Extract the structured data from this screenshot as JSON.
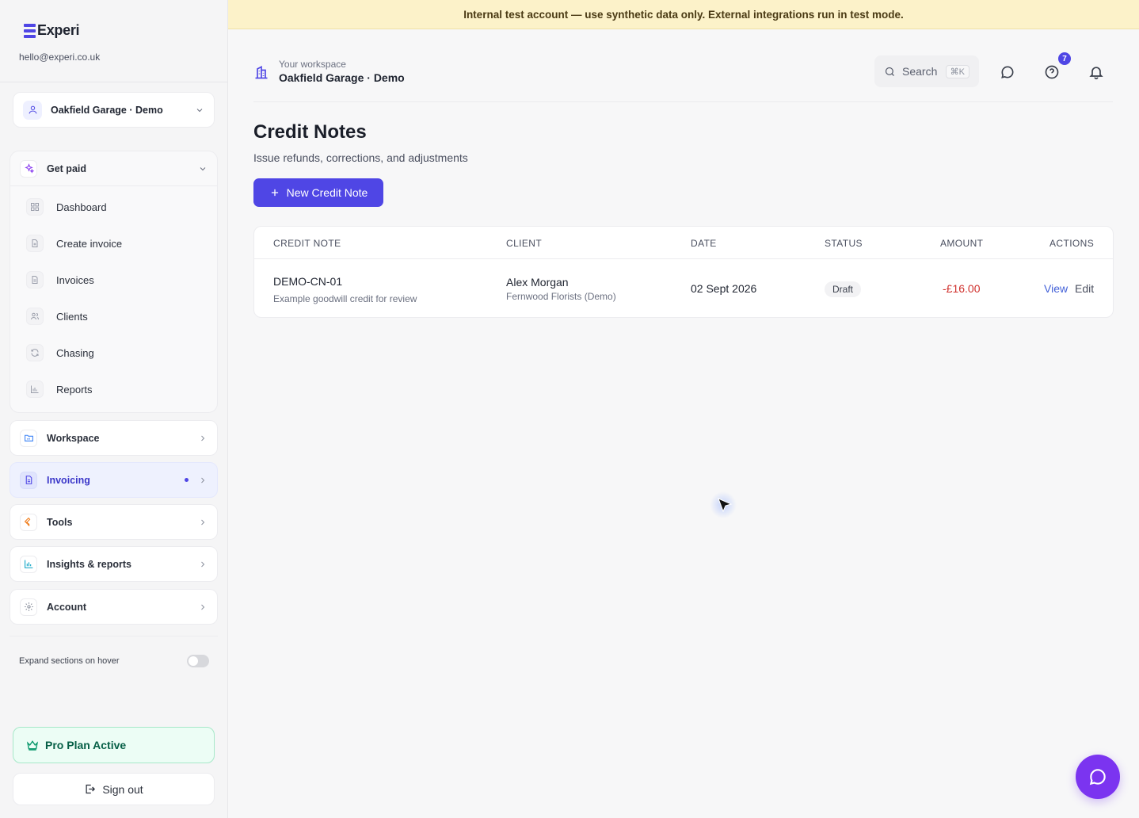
{
  "brand": {
    "name": "Experi",
    "email": "hello@experi.co.uk"
  },
  "workspace_selector": {
    "label": "Oakfield Garage · Demo"
  },
  "nav": {
    "get_paid": {
      "label": "Get paid",
      "items": [
        {
          "label": "Dashboard",
          "icon": "grid-icon"
        },
        {
          "label": "Create invoice",
          "icon": "file-plus-icon"
        },
        {
          "label": "Invoices",
          "icon": "file-text-icon"
        },
        {
          "label": "Clients",
          "icon": "users-icon"
        },
        {
          "label": "Chasing",
          "icon": "refresh-icon"
        },
        {
          "label": "Reports",
          "icon": "bar-chart-icon"
        }
      ]
    },
    "workspace": {
      "label": "Workspace"
    },
    "invoicing": {
      "label": "Invoicing"
    },
    "tools": {
      "label": "Tools"
    },
    "insights": {
      "label": "Insights & reports"
    },
    "account": {
      "label": "Account"
    }
  },
  "hover_toggle": {
    "label": "Expand sections on hover",
    "enabled": false
  },
  "plan": {
    "label": "Pro Plan Active"
  },
  "signout": {
    "label": "Sign out"
  },
  "banner": {
    "text": "Internal test account — use synthetic data only. External integrations run in test mode."
  },
  "topbar": {
    "workspace_caption": "Your workspace",
    "workspace_name": "Oakfield Garage · Demo",
    "search_label": "Search",
    "search_shortcut": "⌘K",
    "help_badge": "7"
  },
  "page": {
    "title": "Credit Notes",
    "subtitle": "Issue refunds, corrections, and adjustments",
    "new_button": "New Credit Note"
  },
  "table": {
    "columns": [
      "CREDIT NOTE",
      "CLIENT",
      "DATE",
      "STATUS",
      "AMOUNT",
      "ACTIONS"
    ],
    "rows": [
      {
        "number": "DEMO-CN-01",
        "description": "Example goodwill credit for review",
        "client": "Alex Morgan",
        "company": "Fernwood Florists (Demo)",
        "date": "02 Sept 2026",
        "status": "Draft",
        "amount": "-£16.00",
        "action_view": "View",
        "action_edit": "Edit"
      }
    ]
  },
  "colors": {
    "accent": "#4f46e5",
    "banner_bg": "#fcf2c9",
    "negative_amount": "#d0312d",
    "plan_bg": "#ecfdf5",
    "chat_fab": "#7b34f0"
  }
}
